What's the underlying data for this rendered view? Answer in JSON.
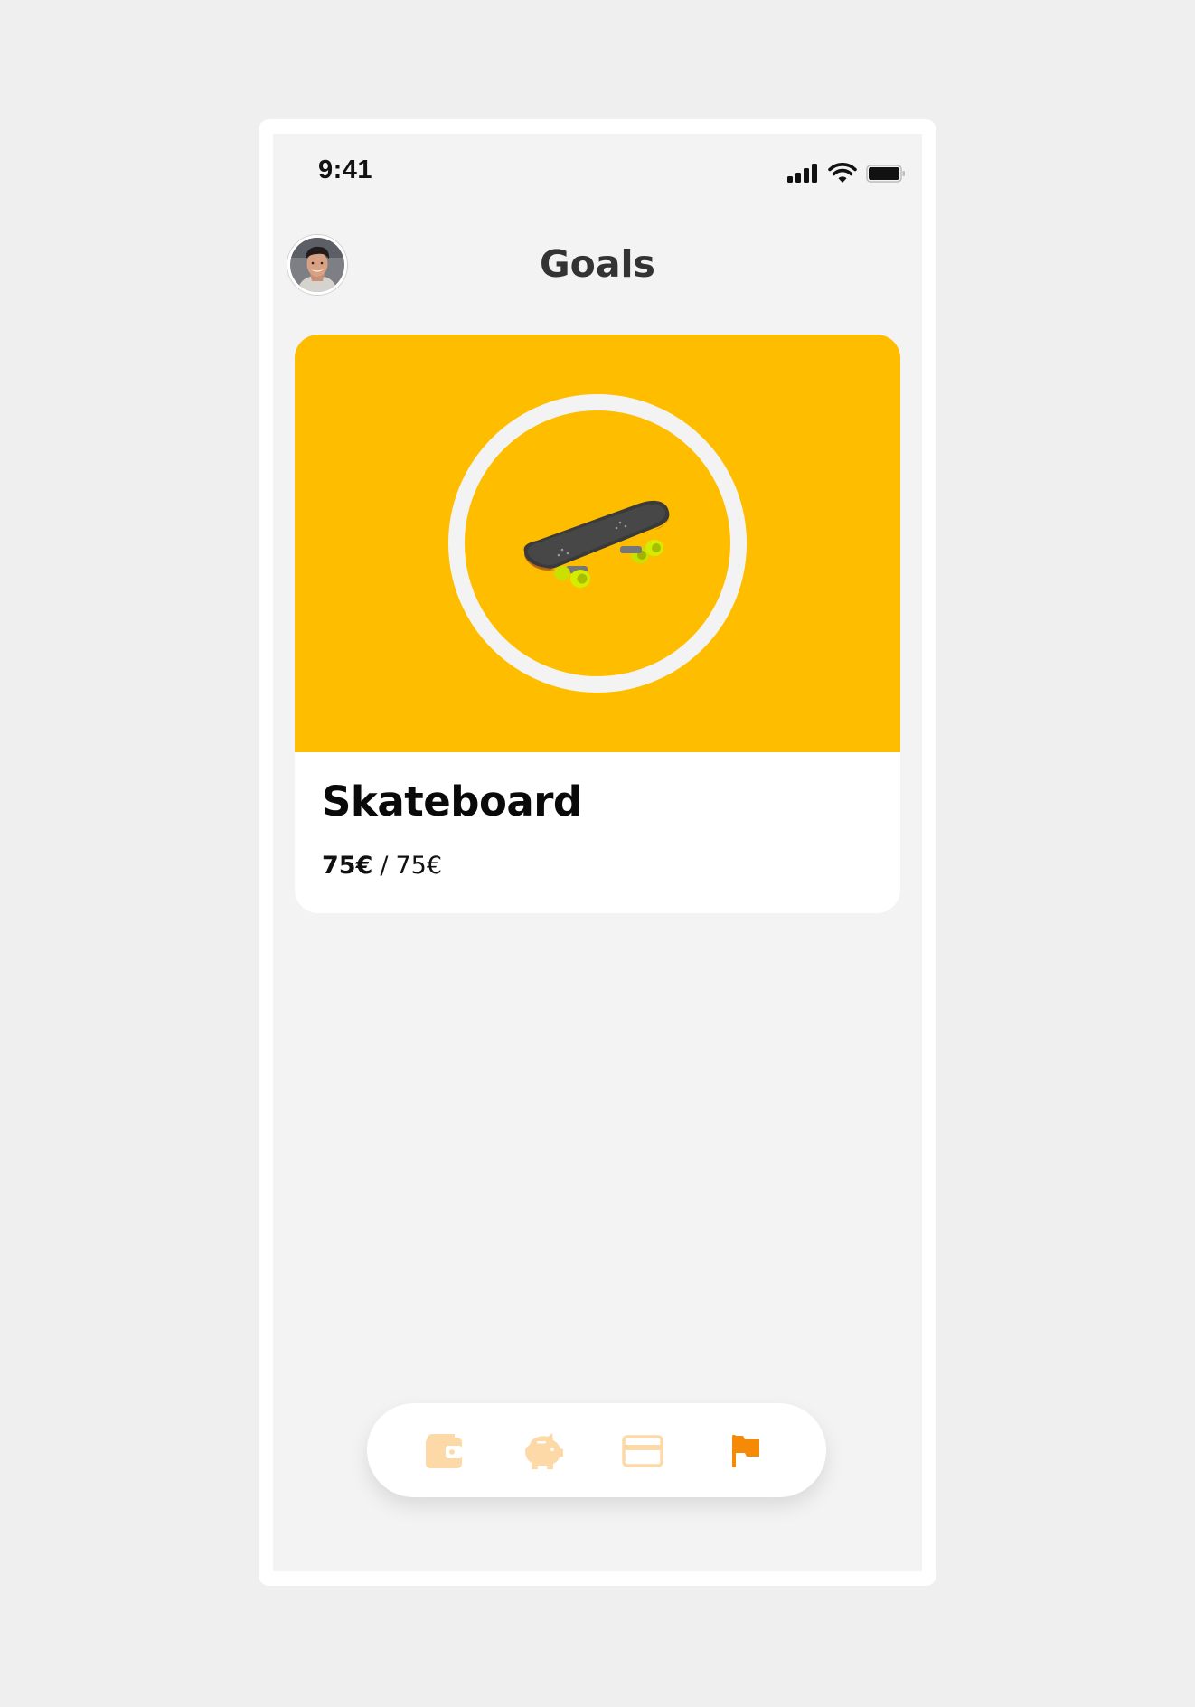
{
  "status_bar": {
    "time": "9:41",
    "icons": [
      "cellular-signal-icon",
      "wifi-icon",
      "battery-icon"
    ]
  },
  "header": {
    "title": "Goals",
    "avatar": "user-avatar"
  },
  "goal": {
    "name": "Skateboard",
    "saved": "75€",
    "separator": "/",
    "target": "75€",
    "image": "skateboard-illustration",
    "accent_color": "#ffbd00"
  },
  "bottom_nav": {
    "items": [
      {
        "icon": "wallet-icon",
        "active": false
      },
      {
        "icon": "piggy-bank-icon",
        "active": false
      },
      {
        "icon": "credit-card-icon",
        "active": false
      },
      {
        "icon": "flag-icon",
        "active": true
      }
    ],
    "active_color": "#f58a07",
    "inactive_color": "#fdd9a8"
  }
}
